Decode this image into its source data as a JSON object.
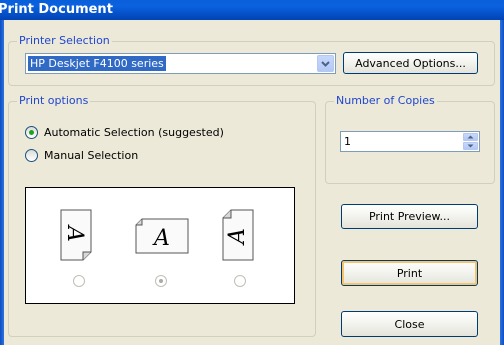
{
  "window": {
    "title": "Print Document"
  },
  "printer_selection": {
    "legend": "Printer Selection",
    "selected_printer": "HP Deskjet F4100 series",
    "advanced_button": "Advanced Options..."
  },
  "print_options": {
    "legend": "Print options",
    "auto_label": "Automatic Selection (suggested)",
    "manual_label": "Manual Selection",
    "auto_checked": true,
    "orientations": [
      {
        "name": "portrait-rotated",
        "glyph": "A"
      },
      {
        "name": "landscape",
        "glyph": "A"
      },
      {
        "name": "portrait-rotated-reverse",
        "glyph": "A"
      }
    ],
    "selected_orientation_index": 1
  },
  "copies": {
    "legend": "Number of Copies",
    "value": "1"
  },
  "buttons": {
    "preview": "Print Preview...",
    "print": "Print",
    "close": "Close"
  },
  "colors": {
    "legend_text": "#1f46d1",
    "selection": "#316ac5",
    "titlebar": "#0a5fd8"
  }
}
